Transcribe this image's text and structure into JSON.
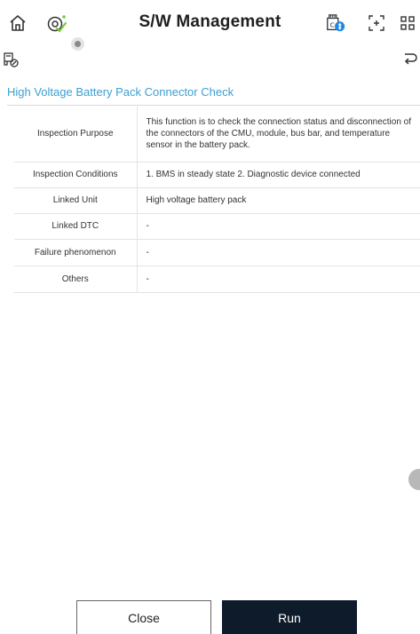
{
  "header": {
    "title": "S/W Management",
    "icons": [
      "home-icon",
      "vehicle-diagnostic-icon",
      "bluetooth-vci-icon",
      "screen-capture-icon",
      "app-grid-icon"
    ]
  },
  "subbar": {
    "icons": [
      "vehicle-status-icon",
      "return-icon"
    ]
  },
  "section": {
    "title": "High Voltage Battery Pack Connector Check"
  },
  "info_table": {
    "rows": [
      {
        "label": "Inspection Purpose",
        "value": "This function is to check the connection status and disconnection of the connectors of the CMU, module, bus bar, and temperature sensor in the battery pack."
      },
      {
        "label": "Inspection Conditions",
        "value": "1. BMS in steady state 2. Diagnostic device connected"
      },
      {
        "label": "Linked Unit",
        "value": "High voltage battery pack"
      },
      {
        "label": "Linked DTC",
        "value": "-"
      },
      {
        "label": "Failure phenomenon",
        "value": "-"
      },
      {
        "label": "Others",
        "value": "-"
      }
    ]
  },
  "buttons": {
    "close_label": "Close",
    "run_label": "Run"
  },
  "colors": {
    "accent": "#3c9fd1",
    "run_button": "#0e1b2b",
    "check_badge": "#7ac943",
    "bluetooth": "#1e88e5"
  }
}
